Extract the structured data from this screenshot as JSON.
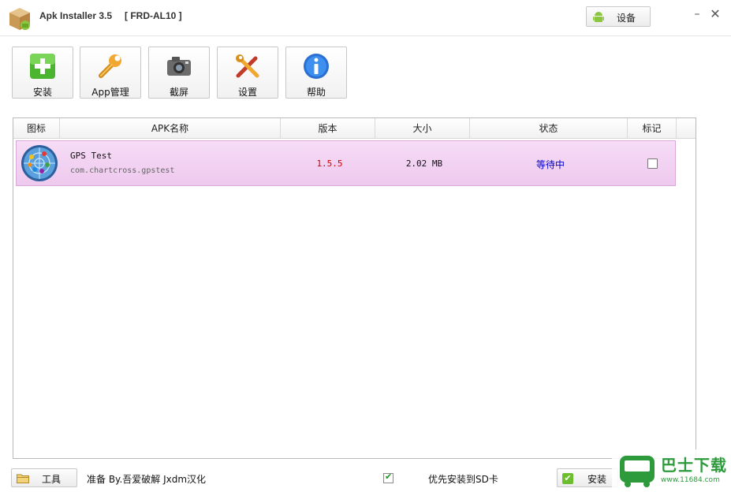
{
  "window": {
    "title": "Apk Installer 3.5",
    "device_name": "[ FRD-AL10 ]",
    "device_button_label": "设备",
    "minimize_label": "–",
    "close_label": "✕"
  },
  "toolbar": [
    {
      "label": "安装",
      "icon": "install-plus-icon"
    },
    {
      "label": "App管理",
      "icon": "wrench-icon"
    },
    {
      "label": "截屏",
      "icon": "camera-icon"
    },
    {
      "label": "设置",
      "icon": "tools-icon"
    },
    {
      "label": "帮助",
      "icon": "info-icon"
    }
  ],
  "table": {
    "headers": {
      "icon": "图标",
      "name": "APK名称",
      "version": "版本",
      "size": "大小",
      "status": "状态",
      "mark": "标记"
    },
    "rows": [
      {
        "icon": "gps-radar-icon",
        "name": "GPS Test",
        "package": "com.chartcross.gpstest",
        "version": "1.5.5",
        "size": "2.02 MB",
        "status": "等待中",
        "marked": false
      }
    ]
  },
  "bottom_bar": {
    "tools_label": "工具",
    "status_text": "准备 By.吾爱破解 Jxdm汉化",
    "sd_option_label": "优先安装到SD卡",
    "sd_option_checked": true,
    "install_label": "安装"
  },
  "watermark": {
    "text": "巴士下载",
    "url": "www.11684.com"
  },
  "colors": {
    "row_highlight": "#f0d0f0",
    "version_text": "#d00000",
    "status_text": "#0000cc",
    "accent_green": "#2d9a3c"
  }
}
